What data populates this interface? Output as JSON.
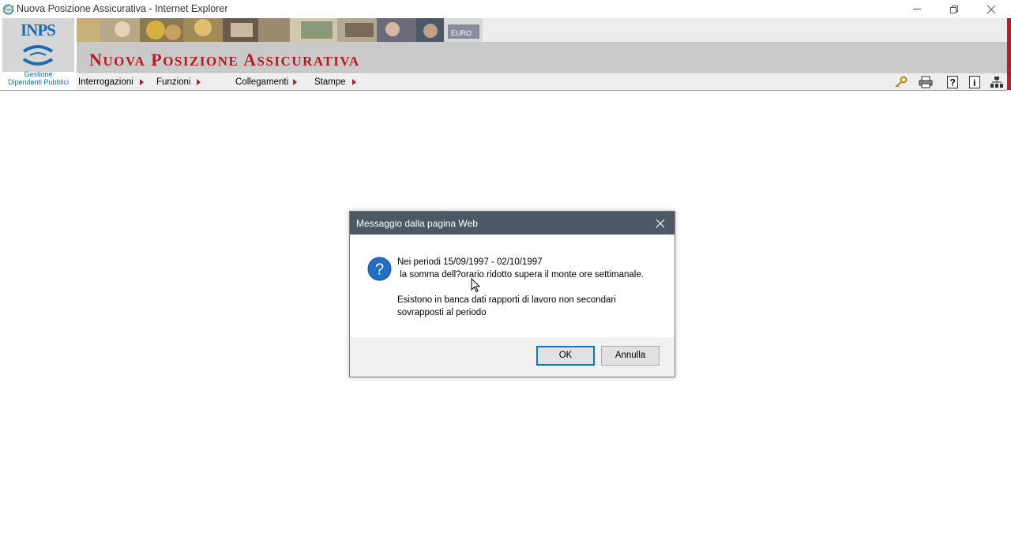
{
  "window": {
    "title": "Nuova Posizione Assicurativa - Internet Explorer"
  },
  "header": {
    "logo_text": "INPS",
    "logo_subtitle_line1": "Gestione",
    "logo_subtitle_line2": "Dipendenti Pubblici",
    "app_title_initial_1": "N",
    "app_title_rest_1": "UOVA",
    "app_title_initial_2": "P",
    "app_title_rest_2": "OSIZIONE",
    "app_title_initial_3": "A",
    "app_title_rest_3": "SSICURATIVA",
    "photo_strip_text": "EURO"
  },
  "menu": {
    "items": [
      {
        "label": "Interrogazioni"
      },
      {
        "label": "Funzioni"
      },
      {
        "label": "Collegamenti"
      },
      {
        "label": "Stampe"
      }
    ]
  },
  "toolbar": {
    "icons": [
      "key-icon",
      "printer-icon",
      "help-icon",
      "info-icon",
      "hierarchy-icon"
    ]
  },
  "dialog": {
    "title": "Messaggio dalla pagina Web",
    "message": "Nei periodi 15/09/1997 - 02/10/1997\n la somma dell?orario ridotto supera il monte ore settimanale.\n\nEsistono in banca dati rapporti di lavoro non secondari\nsovrapposti al periodo",
    "ok_label": "OK",
    "cancel_label": "Annulla"
  },
  "colors": {
    "brand_red": "#b01c22",
    "brand_blue": "#1a6bb5",
    "dialog_titlebar": "#4d5866",
    "focus_blue": "#0078d7"
  }
}
